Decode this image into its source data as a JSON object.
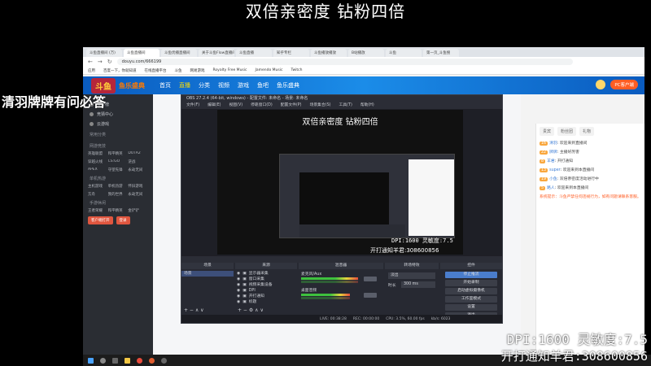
{
  "overlay": {
    "title": "双倍亲密度  钻粉四倍",
    "left_caption": "清羽牌牌有问必答",
    "dpi_line": "DPI:1600 灵敏度:7.5",
    "notify_line": "开打通知羊君:308600856"
  },
  "browser": {
    "url": "douyu.com/666199",
    "tabs": [
      "斗鱼直播间 (万)",
      "斗鱼直播间",
      "斗鱼优播直播间",
      "关于斗鱼Flow直播间",
      "斗鱼直播",
      "知乎专栏",
      "斗鱼播放播放",
      "B站播放",
      "斗鱼",
      "第一页_斗鱼搜"
    ],
    "bookmarks": [
      "应用",
      "百度一下，你就知道",
      "在线直播平台",
      "斗鱼",
      "网易游戏",
      "Royalty Free Music",
      "Jamendo Music",
      "Twitch"
    ]
  },
  "douyu": {
    "logo": "斗鱼",
    "brand": "鱼乐盛典",
    "nav": [
      "首页",
      "直播",
      "分类",
      "视频",
      "游戏",
      "鱼吧",
      "鱼乐盛典"
    ],
    "active_nav": "直播",
    "pc_button": "PC客户端",
    "sidebar": {
      "items": [
        "排行榜",
        "竞猜中心",
        "云游戏"
      ],
      "section_fav": "常用分类",
      "section_hot": "网游竞技",
      "section_pc": "单机热游",
      "section_mobile": "手游休闲",
      "grid_hot": [
        "英雄联盟",
        "和平精英",
        "DOTA2",
        "穿越火线",
        "CS:GO",
        "逆战",
        "APEX",
        "守望先锋",
        "永劫无间"
      ],
      "grid_pc": [
        "主机游戏",
        "单机热游",
        "怀旧游戏",
        "方舟",
        "我的世界",
        "永劫无间"
      ],
      "grid_mobile": [
        "王者荣耀",
        "和平精英",
        "金铲铲"
      ],
      "btn_client": "客户端打开",
      "btn_login": "登录"
    },
    "chat": {
      "tabs": [
        "贵宾",
        "粉丝团",
        "礼物"
      ],
      "lines": [
        {
          "level": "16",
          "name": "清羽",
          "text": "欢迎来到直播间"
        },
        {
          "level": "22",
          "name": "牌牌",
          "text": "主播好厉害"
        },
        {
          "level": "8",
          "name": "羊君",
          "text": "开打通知"
        },
        {
          "level": "13",
          "name": "super",
          "text": "欢迎来到本直播间"
        },
        {
          "level": "19",
          "name": "小鱼",
          "text": "双倍亲密度活动进行中"
        },
        {
          "level": "5",
          "name": "路人",
          "text": "欢迎来到本直播间"
        }
      ],
      "notice": "系统提示：斗鱼严禁任何违规行为，如有问题请联系客服。"
    }
  },
  "obs": {
    "title": "OBS 27.2.4 (64-bit, windows) - 配置文件: 未命名 - 场景: 未命名",
    "menu": [
      "文件(F)",
      "编辑(E)",
      "视图(V)",
      "停靠窗口(D)",
      "配置文件(P)",
      "场景集合(S)",
      "工具(T)",
      "帮助(H)"
    ],
    "preview_title": "双倍亲密度  钻粉四倍",
    "preview_dpi": "DPI:1600 灵敏度:7.5",
    "preview_notify": "开打通知羊君:308600856",
    "docks": {
      "scenes_hdr": "场景",
      "sources_hdr": "来源",
      "mixer_hdr": "混音器",
      "transitions_hdr": "转场特效",
      "controls_hdr": "控件",
      "scene_items": [
        "场景"
      ],
      "source_items": [
        "显示器采集",
        "窗口采集",
        "视频采集设备",
        "DPI",
        "开打通知",
        "标题"
      ],
      "mixer_tracks": [
        "麦克风/Aux",
        "桌面音频"
      ],
      "transition": "淡出",
      "duration_label": "时长",
      "duration_value": "300 ms",
      "controls": [
        "停止推流",
        "开始录制",
        "启动虚拟摄像机",
        "工作室模式",
        "设置",
        "退出"
      ]
    },
    "status": {
      "live": "LIVE: 00:38:28",
      "rec": "REC: 00:00:00",
      "cpu": "CPU: 3.5%, 60.00 fps",
      "kbps": "kb/s: 6023"
    },
    "source_label": "未选择源"
  },
  "taskbar": {
    "icons": [
      "windows-start",
      "search",
      "task-view",
      "file-explorer",
      "chrome",
      "obs",
      "netease"
    ]
  }
}
